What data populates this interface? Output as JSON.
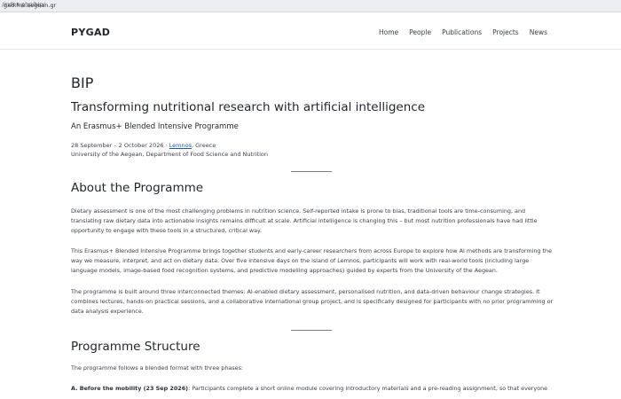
{
  "browser": {
    "url_host": "gad.fns.aegean.gr",
    "url_path": "/index.php/bip/"
  },
  "site": {
    "logo": "PYGAD",
    "nav": [
      "Home",
      "People",
      "Publications",
      "Projects",
      "News"
    ]
  },
  "page": {
    "title": "BIP",
    "subtitle": "Transforming nutritional research with artificial intelligence",
    "tagline": "An Erasmus+ Blended Intensive Programme",
    "date_text": "28 September – 2 October 2026 · ",
    "location_link": "Lemnos",
    "country_text": ", Greece",
    "institution": "University of the Aegean, Department of Food Science and Nutrition"
  },
  "about": {
    "heading": "About the Programme",
    "p1": "Dietary assessment is one of the most challenging problems in nutrition science. Self-reported intake is prone to bias, traditional tools are time-consuming, and translating raw dietary data into actionable insights remains difficult at scale. Artificial intelligence is changing this – but most nutrition professionals have had little opportunity to engage with these tools in a structured, critical way.",
    "p2": "This Erasmus+ Blended Intensive Programme brings together students and early-career researchers from across Europe to explore how AI methods are transforming the way we measure, interpret, and act on dietary data. Over five intensive days on the island of Lemnos, participants will work with real-world tools (including large language models, image-based food recognition systems, and predictive modelling approaches) guided by experts from the University of the Aegean.",
    "p3": "The programme is built around three interconnected themes: AI-enabled dietary assessment, personalised nutrition, and data-driven behaviour change strategies. It combines lectures, hands-on practical sessions, and a collaborative international group project, and is specifically designed for participants with no prior programming or data analysis experience."
  },
  "structure": {
    "heading": "Programme Structure",
    "intro": "The programme follows a blended format with three phases:",
    "phase_a_label": "A. Before the mobility (23 Sep 2026)",
    "phase_a_text": ": Participants complete a short online module covering introductory materials and a pre-reading assignment, so that everyone"
  }
}
